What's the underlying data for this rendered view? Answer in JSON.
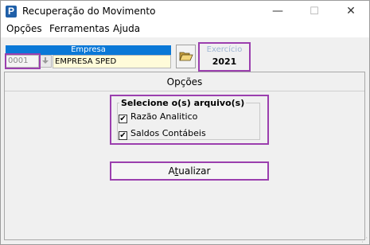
{
  "window": {
    "title": "Recuperação do Movimento",
    "icon_letter": "P",
    "controls": {
      "minimize": "—",
      "maximize": "☐",
      "close": "✕"
    }
  },
  "menu": [
    {
      "label": "Opções"
    },
    {
      "label": "Ferramentas"
    },
    {
      "label": "Ajuda"
    }
  ],
  "empresa": {
    "header": "Empresa",
    "code": "0001",
    "name": "EMPRESA SPED"
  },
  "exercicio": {
    "label": "Exercício",
    "value": "2021"
  },
  "options_panel": {
    "title": "Opções",
    "group_title": "Selecione o(s) arquivo(s)",
    "checkboxes": [
      {
        "label": "Razão Analitico",
        "checked": true
      },
      {
        "label": "Saldos Contábeis",
        "checked": true
      }
    ]
  },
  "actions": {
    "update_first": "A",
    "update_underlined": "t",
    "update_rest": "ualizar"
  },
  "colors": {
    "empresa_header": "#0a78d7",
    "highlight": "#9b3fae",
    "name_field_bg": "#fffbd9",
    "exercicio_label": "#9fb6d4"
  },
  "icons": [
    "app-icon",
    "minimize-icon",
    "maximize-icon",
    "close-icon",
    "dropdown-arrow-icon",
    "open-folder-icon",
    "checkmark-icon"
  ]
}
